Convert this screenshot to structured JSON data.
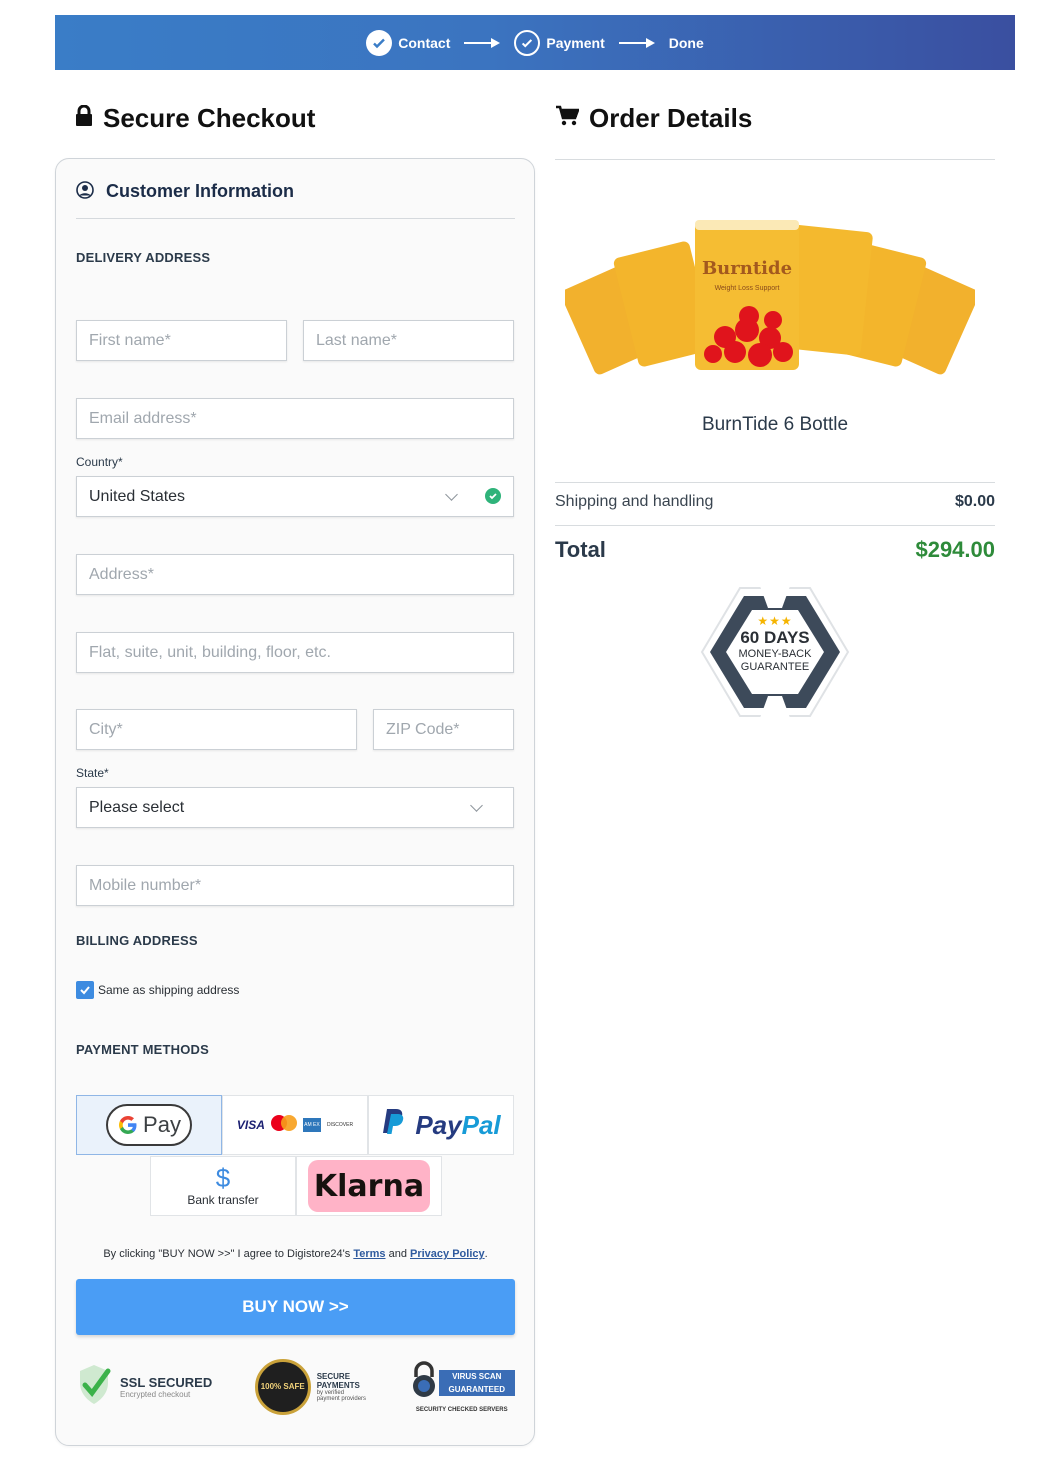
{
  "progress": {
    "steps": [
      {
        "label": "Contact"
      },
      {
        "label": "Payment"
      },
      {
        "label": "Done"
      }
    ]
  },
  "checkout": {
    "title": "Secure Checkout",
    "section_title": "Customer Information",
    "delivery_label": "DELIVERY ADDRESS",
    "fields": {
      "first_name": "First name*",
      "last_name": "Last name*",
      "email": "Email address*",
      "country_label": "Country*",
      "country_value": "United States",
      "address": "Address*",
      "address2": "Flat, suite, unit, building, floor, etc.",
      "city": "City*",
      "zip": "ZIP Code*",
      "state_label": "State*",
      "state_value": "Please select",
      "mobile": "Mobile number*"
    },
    "billing_label": "BILLING ADDRESS",
    "same_as_shipping": "Same as shipping address",
    "payment_label": "PAYMENT METHODS",
    "payment": {
      "gpay": "Pay",
      "visa": "VISA",
      "amex": "AM EX",
      "discover": "DISCOVER",
      "paypal": "PayPal",
      "bank": "Bank transfer",
      "klarna": "Klarna"
    },
    "terms": {
      "prefix": "By clicking \"BUY NOW >>\" I agree to Digistore24's",
      "terms_link": "Terms",
      "and": "and",
      "privacy_link": "Privacy Policy",
      "suffix": "."
    },
    "buy_button": "BUY NOW >>",
    "badges": {
      "ssl_title": "SSL SECURED",
      "ssl_sub": "Encrypted checkout",
      "safe": "100% SAFE",
      "secure_title_1": "SECURE",
      "secure_title_2": "PAYMENTS",
      "secure_sub_1": "by verified",
      "secure_sub_2": "payment providers",
      "virus_1": "VIRUS SCAN",
      "virus_2": "GUARANTEED",
      "virus_sub": "SECURITY CHECKED SERVERS"
    }
  },
  "order": {
    "title": "Order Details",
    "product_name": "BurnTide 6 Bottle",
    "product_brand": "Burntide",
    "product_sub": "Weight Loss Support",
    "shipping_label": "Shipping and handling",
    "shipping_value": "$0.00",
    "total_label": "Total",
    "total_value": "$294.00",
    "guarantee": {
      "stars": "★★★",
      "days": "60 DAYS",
      "line1": "MONEY-BACK",
      "line2": "GUARANTEE"
    }
  },
  "colors": {
    "accent": "#4a9df5",
    "total_green": "#2e8b3a",
    "progress_start": "#3a7dc7",
    "progress_end": "#3a4fa0"
  }
}
